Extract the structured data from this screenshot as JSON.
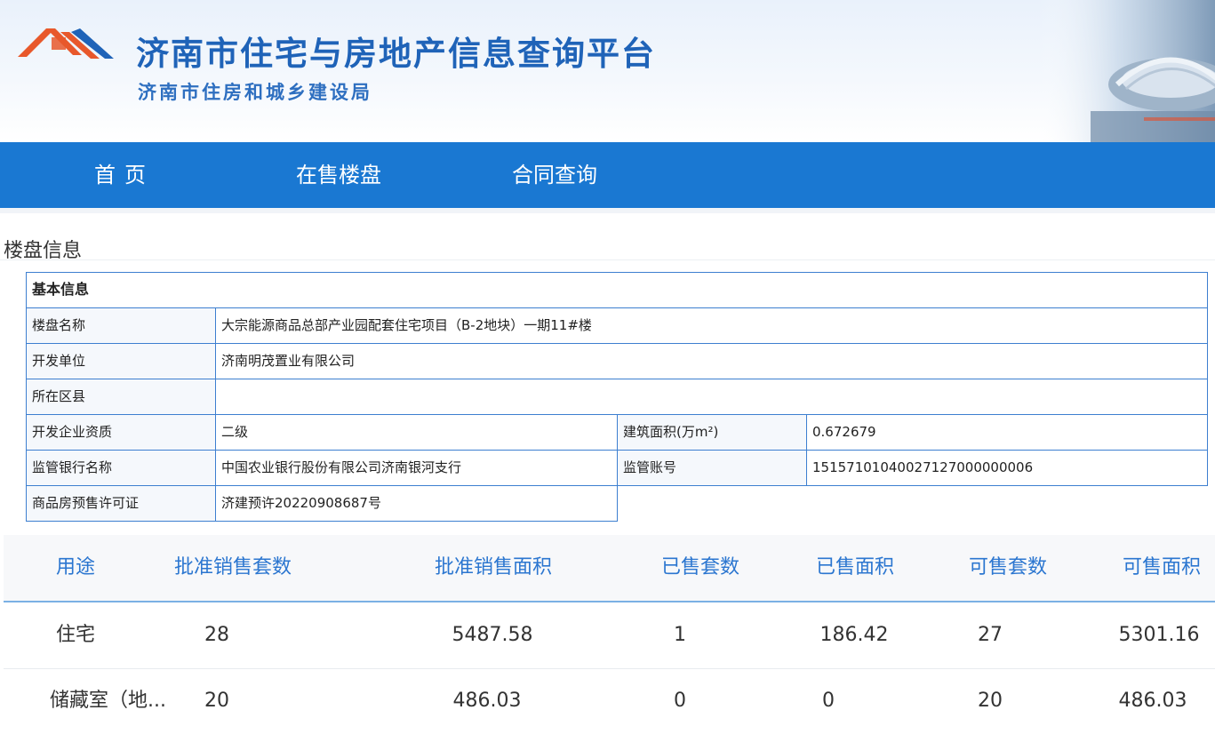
{
  "header": {
    "title": "济南市住宅与房地产信息查询平台",
    "subtitle": "济南市住房和城乡建设局",
    "logo_icon": "roof-logo-icon",
    "brand_color": "#1f63b8"
  },
  "nav": {
    "items": [
      "首页",
      "在售楼盘",
      "合同查询"
    ],
    "background": "#1a78d2"
  },
  "section": {
    "title": "楼盘信息"
  },
  "info": {
    "header": "基本信息",
    "project_name_label": "楼盘名称",
    "project_name_value": "大宗能源商品总部产业园配套住宅项目（B-2地块）一期11#楼",
    "developer_label": "开发单位",
    "developer_value": "济南明茂置业有限公司",
    "district_label": "所在区县",
    "district_value": "",
    "qualification_label": "开发企业资质",
    "qualification_value": "二级",
    "area_label": "建筑面积(万m²)",
    "area_value": "0.672679",
    "bank_label": "监管银行名称",
    "bank_value": "中国农业银行股份有限公司济南银河支行",
    "account_label": "监管账号",
    "account_value": "15157101040027127000000006",
    "permit_label": "商品房预售许可证",
    "permit_value": "济建预许20220908687号"
  },
  "sales_table": {
    "columns": [
      "用途",
      "批准销售套数",
      "批准销售面积",
      "已售套数",
      "已售面积",
      "可售套数",
      "可售面积"
    ],
    "rows": [
      [
        "住宅",
        "28",
        "5487.58",
        "1",
        "186.42",
        "27",
        "5301.16"
      ],
      [
        "储藏室（地...",
        "20",
        "486.03",
        "0",
        "0",
        "20",
        "486.03"
      ]
    ],
    "header_color": "#2b76d0"
  }
}
